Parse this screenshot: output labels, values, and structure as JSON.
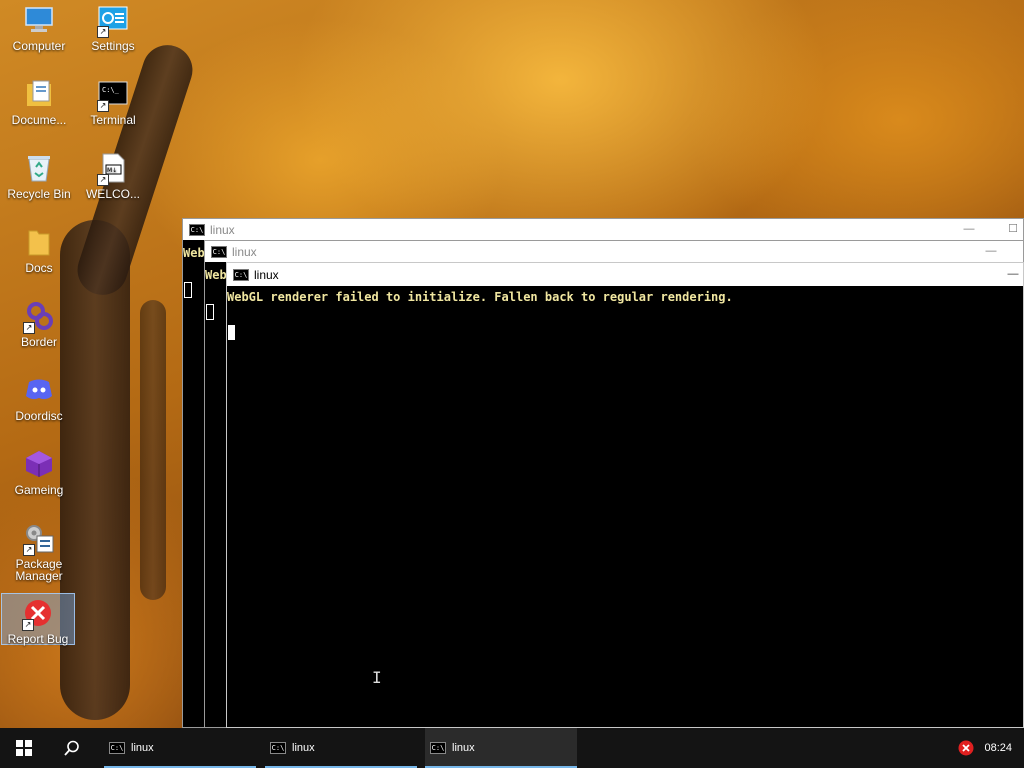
{
  "desktop": {
    "icons": [
      {
        "label": "Computer"
      },
      {
        "label": "Settings"
      },
      {
        "label": "Docume..."
      },
      {
        "label": "Terminal"
      },
      {
        "label": "Recycle Bin"
      },
      {
        "label": "WELCO..."
      },
      {
        "label": "Docs"
      },
      {
        "label": "Border"
      },
      {
        "label": "Doordisc"
      },
      {
        "label": "Gameing"
      },
      {
        "label": "Package Manager"
      },
      {
        "label": "Report Bug"
      }
    ]
  },
  "windows": [
    {
      "title": "linux",
      "partial_text": "Web"
    },
    {
      "title": "linux",
      "partial_text": "Web"
    },
    {
      "title": "linux",
      "text": "WebGL renderer failed to initialize. Fallen back to regular rendering."
    }
  ],
  "icon_glyph": "C:\\",
  "taskbar": {
    "start_icon": "windows-logo-icon",
    "search_icon": "search-icon",
    "tasks": [
      {
        "label": "linux"
      },
      {
        "label": "linux"
      },
      {
        "label": "linux"
      }
    ],
    "clock": "08:24"
  },
  "colors": {
    "taskbar_bg": "#141414",
    "task_underline": "#77b7ea",
    "terminal_text": "#f0e6a0",
    "error_badge": "#e02020"
  }
}
